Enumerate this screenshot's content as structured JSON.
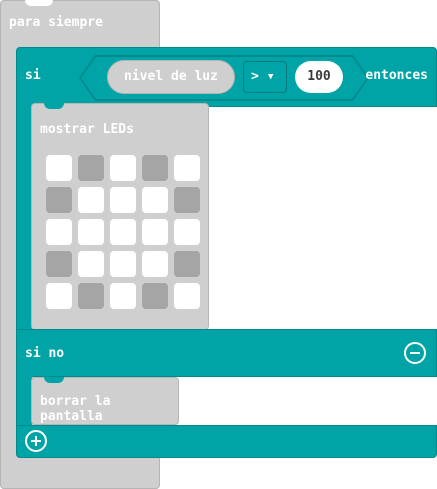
{
  "forever": {
    "label": "para siempre"
  },
  "if_block": {
    "if_label": "si",
    "then_label": "entonces",
    "else_label": "si no",
    "condition": {
      "sensor_label": "nivel de luz",
      "operator": ">",
      "value": "100"
    }
  },
  "show_leds": {
    "label": "mostrar LEDs",
    "grid": [
      [
        0,
        1,
        0,
        1,
        0
      ],
      [
        1,
        0,
        0,
        0,
        1
      ],
      [
        0,
        0,
        0,
        0,
        0
      ],
      [
        1,
        0,
        0,
        0,
        1
      ],
      [
        0,
        1,
        0,
        1,
        0
      ]
    ]
  },
  "clear_screen": {
    "label": "borrar la pantalla"
  },
  "icons": {
    "remove": "minus-circle-icon",
    "add": "plus-circle-icon",
    "dropdown": "caret-down-icon"
  },
  "colors": {
    "logic": "#00a4a6",
    "basic": "#cfcfcf"
  }
}
